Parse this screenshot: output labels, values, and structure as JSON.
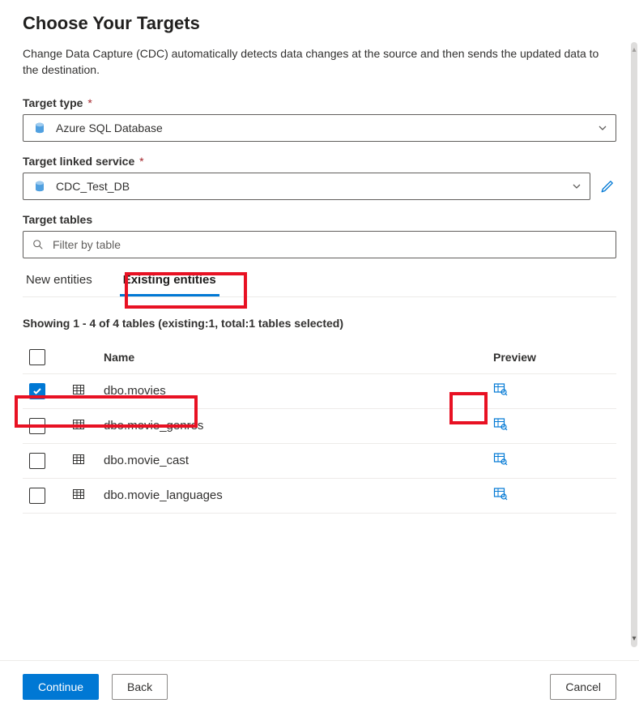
{
  "title": "Choose Your Targets",
  "description": "Change Data Capture (CDC) automatically detects data changes at the source and then sends the updated data to the destination.",
  "target_type": {
    "label": "Target type",
    "required": "*",
    "value": "Azure SQL Database"
  },
  "linked_service": {
    "label": "Target linked service",
    "required": "*",
    "value": "CDC_Test_DB"
  },
  "target_tables": {
    "label": "Target tables",
    "filter_placeholder": "Filter by table"
  },
  "tabs": {
    "items": [
      {
        "label": "New entities",
        "active": false
      },
      {
        "label": "Existing entities",
        "active": true
      }
    ]
  },
  "showing": "Showing 1 - 4 of 4 tables (existing:1, total:1 tables selected)",
  "table": {
    "headers": {
      "name": "Name",
      "preview": "Preview"
    },
    "rows": [
      {
        "name": "dbo.movies",
        "checked": true
      },
      {
        "name": "dbo.movie_genres",
        "checked": false
      },
      {
        "name": "dbo.movie_cast",
        "checked": false
      },
      {
        "name": "dbo.movie_languages",
        "checked": false
      }
    ]
  },
  "footer": {
    "continue": "Continue",
    "back": "Back",
    "cancel": "Cancel"
  },
  "colors": {
    "primary": "#0078d4",
    "danger": "#e81123"
  }
}
